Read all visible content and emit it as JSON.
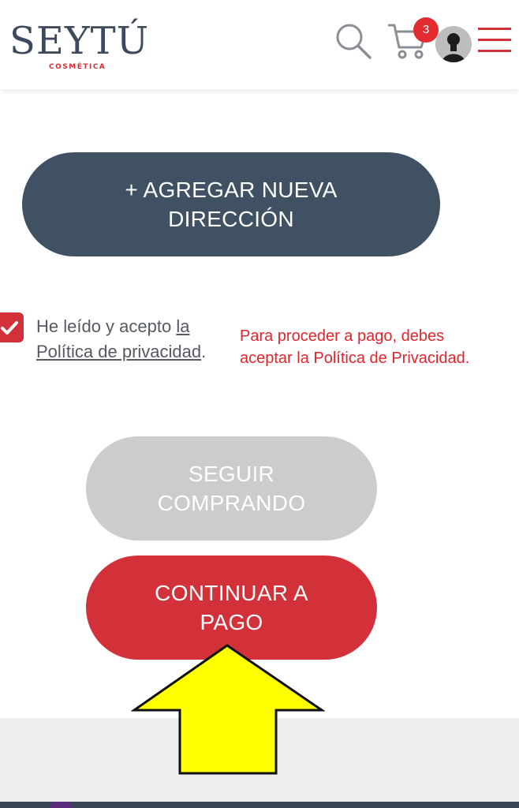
{
  "header": {
    "logo_text": "SEYTÚ",
    "logo_subtitle": "COSMÉTICA",
    "cart_count": "3",
    "icons": [
      "search-icon",
      "cart-icon",
      "user-avatar-icon",
      "menu-icon"
    ]
  },
  "address": {
    "add_label": "+ AGREGAR NUEVA DIRECCIÓN"
  },
  "consent": {
    "checked": true,
    "text_before": "He leído y acepto ",
    "link_text": "la Política de privacidad",
    "text_after": ".",
    "error_message": "Para proceder a pago, debes aceptar la Política de Privacidad."
  },
  "actions": {
    "keep_shopping_label": "SEGUIR COMPRANDO",
    "continue_label": "CONTINUAR A PAGO"
  },
  "colors": {
    "brand_dark": "#3f5163",
    "brand_red": "#d3313a",
    "disabled_gray": "#cccccc",
    "error_red": "#e0252c",
    "arrow_yellow": "#ffff00"
  }
}
